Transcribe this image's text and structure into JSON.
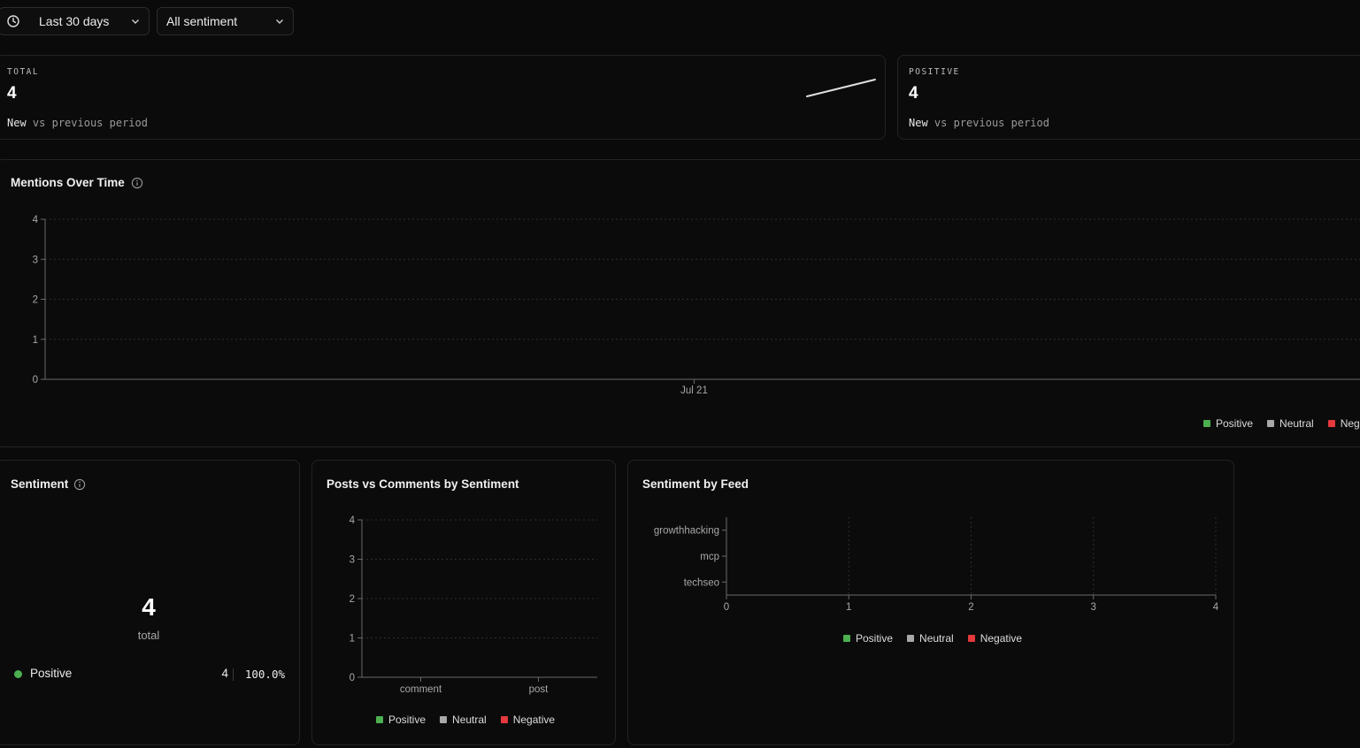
{
  "filters": {
    "date_range": "Last 30 days",
    "sentiment": "All sentiment"
  },
  "kpis": [
    {
      "label": "TOTAL",
      "value": "4",
      "sub_new": "New",
      "sub_rest": "vs previous period"
    },
    {
      "label": "POSITIVE",
      "value": "4",
      "sub_new": "New",
      "sub_rest": "vs previous period"
    }
  ],
  "mentions_chart": {
    "title": "Mentions Over Time",
    "y_ticks": [
      "0",
      "1",
      "2",
      "3",
      "4"
    ],
    "x_ticks": [
      "Jul 21"
    ],
    "legend": [
      "Positive",
      "Neutral",
      "Nega"
    ]
  },
  "sentiment_card": {
    "title": "Sentiment",
    "total_value": "4",
    "total_label": "total",
    "rows": [
      {
        "label": "Positive",
        "count": "4",
        "pct": "100.0%"
      }
    ]
  },
  "posts_comments_card": {
    "title": "Posts vs Comments by Sentiment",
    "y_ticks": [
      "0",
      "1",
      "2",
      "3",
      "4"
    ],
    "x_ticks": [
      "comment",
      "post"
    ],
    "legend": [
      "Positive",
      "Neutral",
      "Negative"
    ]
  },
  "feed_card": {
    "title": "Sentiment by Feed",
    "y_ticks": [
      "growthhacking",
      "mcp",
      "techseo"
    ],
    "x_ticks": [
      "0",
      "1",
      "2",
      "3",
      "4"
    ],
    "legend": [
      "Positive",
      "Neutral",
      "Negative"
    ]
  },
  "colors": {
    "positive": "#4caf50",
    "neutral": "#a8a8a8",
    "negative": "#e5393c"
  },
  "chart_data": [
    {
      "type": "line",
      "title": "Mentions Over Time",
      "x": [
        "Jul 21"
      ],
      "ylim": [
        0,
        4
      ],
      "series": [
        {
          "name": "Positive",
          "values": []
        },
        {
          "name": "Neutral",
          "values": []
        },
        {
          "name": "Negative",
          "values": []
        }
      ],
      "grid": true,
      "legend_position": "bottom-right"
    },
    {
      "type": "bar",
      "title": "Posts vs Comments by Sentiment",
      "categories": [
        "comment",
        "post"
      ],
      "ylim": [
        0,
        4
      ],
      "series": [
        {
          "name": "Positive",
          "values": []
        },
        {
          "name": "Neutral",
          "values": []
        },
        {
          "name": "Negative",
          "values": []
        }
      ],
      "grid": true,
      "legend_position": "bottom-center"
    },
    {
      "type": "bar",
      "title": "Sentiment by Feed",
      "orientation": "horizontal",
      "categories": [
        "growthhacking",
        "mcp",
        "techseo"
      ],
      "xlim": [
        0,
        4
      ],
      "series": [
        {
          "name": "Positive",
          "values": []
        },
        {
          "name": "Neutral",
          "values": []
        },
        {
          "name": "Negative",
          "values": []
        }
      ],
      "grid": true,
      "legend_position": "bottom-center"
    }
  ]
}
